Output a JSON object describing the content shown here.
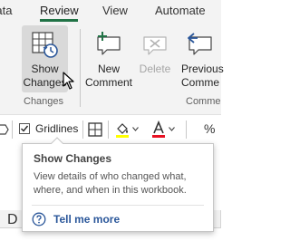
{
  "tabs": [
    {
      "label": "Data",
      "active": false
    },
    {
      "label": "Review",
      "active": true
    },
    {
      "label": "View",
      "active": false
    },
    {
      "label": "Automate",
      "active": false
    }
  ],
  "ribbon": {
    "show_changes": {
      "line1": "Show",
      "line2": "Changes",
      "icon": "show-changes-icon",
      "state": "hover"
    },
    "new_comment": {
      "line1": "New",
      "line2": "Comment",
      "icon": "new-comment-icon"
    },
    "delete": {
      "line1": "Delete",
      "icon": "delete-comment-icon",
      "state": "disabled"
    },
    "previous_comment": {
      "line1": "Previous",
      "line2": "Comme",
      "icon": "previous-comment-icon"
    },
    "groups": {
      "changes": "Changes",
      "comments": "Comme"
    }
  },
  "format_strip": {
    "gridlines_label": "Gridlines",
    "gridlines_checked": true,
    "fill_color": "#ffff00",
    "font_color": "#e81123",
    "percent_label": "%"
  },
  "tooltip": {
    "title": "Show Changes",
    "description": "View details of who changed what, where, and when in this workbook.",
    "help_link": "Tell me more"
  },
  "sheet": {
    "column_letter": "D"
  },
  "colors": {
    "accent": "#217346",
    "link": "#2b579a",
    "hover": "#d9d9d9"
  }
}
